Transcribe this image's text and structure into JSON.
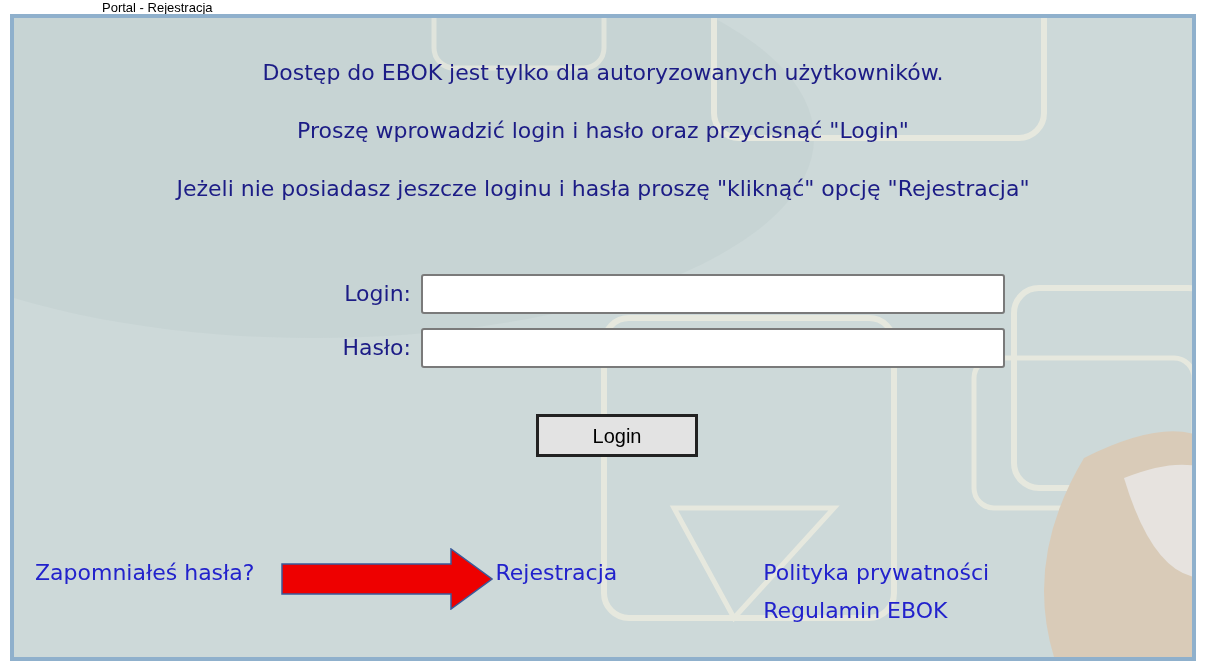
{
  "page_title": "Portal - Rejestracja",
  "messages": [
    "Dostęp do EBOK jest tylko dla autoryzowanych użytkowników.",
    "Proszę wprowadzić login i hasło oraz przycisnąć \"Login\"",
    "Jeżeli nie posiadasz jeszcze loginu i hasła proszę \"kliknąć\" opcję \"Rejestracja\""
  ],
  "fields": [
    {
      "label": "Login:"
    },
    {
      "label": "Hasło:"
    }
  ],
  "login_button": "Login",
  "links": [
    {
      "label": "Zapomniałeś hasła?"
    },
    {
      "label": "Rejestracja"
    },
    {
      "label": "Polityka prywatności"
    },
    {
      "label": "Regulamin EBOK"
    }
  ]
}
